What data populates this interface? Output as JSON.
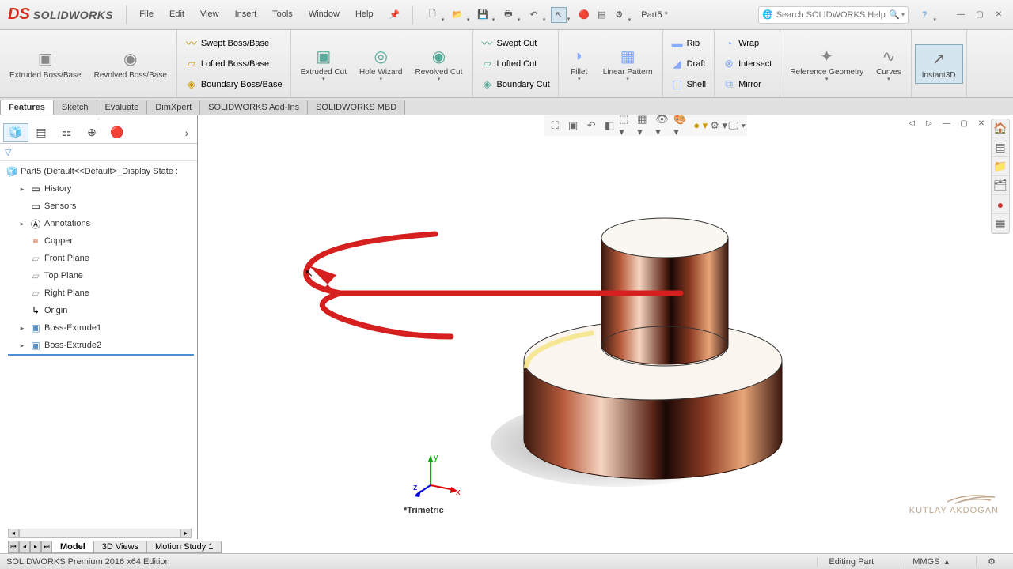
{
  "title": {
    "app": "SOLIDWORKS",
    "partname": "Part5 *"
  },
  "menu": {
    "file": "File",
    "edit": "Edit",
    "view": "View",
    "insert": "Insert",
    "tools": "Tools",
    "window": "Window",
    "help": "Help"
  },
  "search": {
    "placeholder": "Search SOLIDWORKS Help"
  },
  "ribbon": {
    "extruded_boss": "Extruded Boss/Base",
    "revolved_boss": "Revolved Boss/Base",
    "swept_boss": "Swept Boss/Base",
    "lofted_boss": "Lofted Boss/Base",
    "boundary_boss": "Boundary Boss/Base",
    "extruded_cut": "Extruded Cut",
    "hole_wizard": "Hole Wizard",
    "revolved_cut": "Revolved Cut",
    "swept_cut": "Swept Cut",
    "lofted_cut": "Lofted Cut",
    "boundary_cut": "Boundary Cut",
    "fillet": "Fillet",
    "linear_pattern": "Linear Pattern",
    "rib": "Rib",
    "draft": "Draft",
    "shell": "Shell",
    "wrap": "Wrap",
    "intersect": "Intersect",
    "mirror": "Mirror",
    "ref_geom": "Reference Geometry",
    "curves": "Curves",
    "instant3d": "Instant3D"
  },
  "tabs": {
    "features": "Features",
    "sketch": "Sketch",
    "evaluate": "Evaluate",
    "dimxpert": "DimXpert",
    "addins": "SOLIDWORKS Add-Ins",
    "mbd": "SOLIDWORKS MBD"
  },
  "tree": {
    "root": "Part5  (Default<<Default>_Display State :",
    "history": "History",
    "sensors": "Sensors",
    "annotations": "Annotations",
    "material": "Copper",
    "front": "Front Plane",
    "top": "Top Plane",
    "right": "Right Plane",
    "origin": "Origin",
    "boss1": "Boss-Extrude1",
    "boss2": "Boss-Extrude2"
  },
  "viewport": {
    "view_label": "*Trimetric",
    "triad": {
      "x": "x",
      "y": "y",
      "z": "z"
    }
  },
  "watermark": "KUTLAY AKDOGAN",
  "bottom_tabs": {
    "model": "Model",
    "views3d": "3D Views",
    "motion": "Motion Study 1"
  },
  "status": {
    "edition": "SOLIDWORKS Premium 2016 x64 Edition",
    "mode": "Editing Part",
    "units": "MMGS"
  }
}
